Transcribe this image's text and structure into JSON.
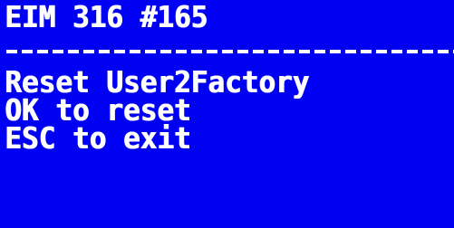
{
  "terminal": {
    "header": "EIM 316 #165",
    "line1": "Reset User2Factory",
    "line2": "OK to reset",
    "line3": "ESC to exit"
  },
  "colors": {
    "background": "#0000f2",
    "text": "#ffffff"
  }
}
